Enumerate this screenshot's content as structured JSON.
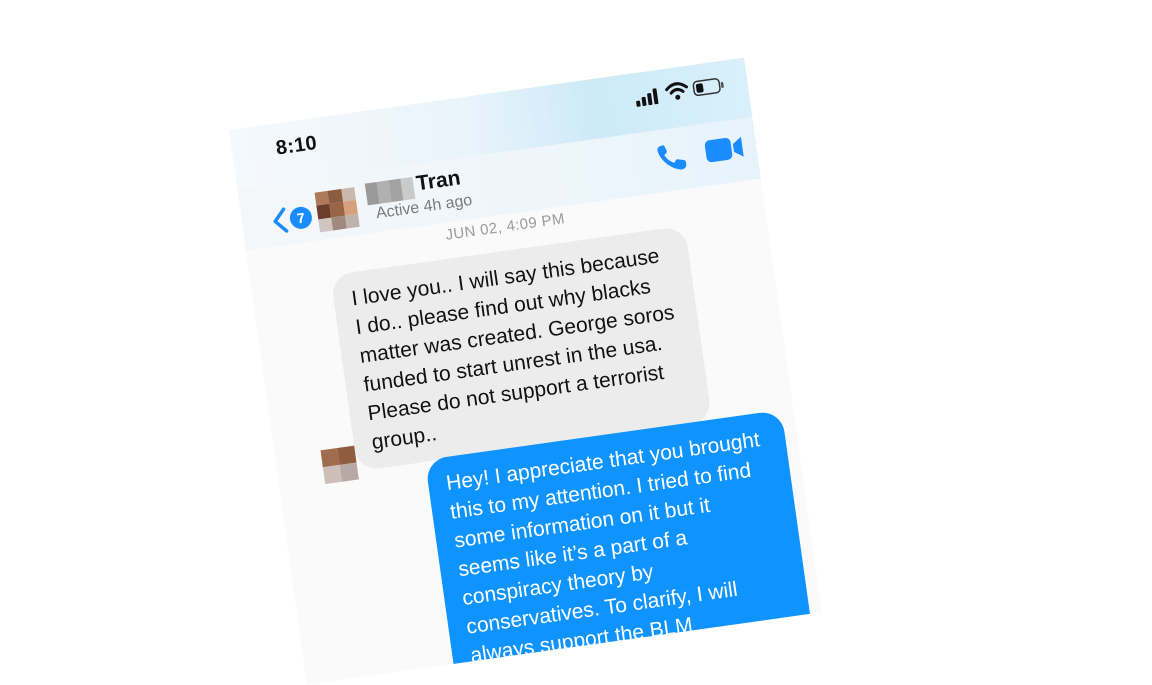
{
  "status_bar": {
    "time": "8:10",
    "icons": [
      "signal-icon",
      "wifi-icon",
      "battery-icon"
    ]
  },
  "header": {
    "back_badge_count": "7",
    "contact_name": "Tran",
    "contact_status": "Active 4h ago",
    "icons": [
      "chevron-left-icon",
      "phone-icon",
      "video-camera-icon"
    ]
  },
  "thread": {
    "date_stamp": "JUN 02, 4:09 PM",
    "messages": [
      {
        "direction": "incoming",
        "text": "I love you.. I will say this because I do.. please find out why blacks matter was created. George soros funded to start unrest in the usa. Please do not support a terrorist group.."
      },
      {
        "direction": "outgoing",
        "text": "Hey! I appreciate that you brought this to my attention. I tried to find some information on it but it seems like it’s a part of a conspiracy theory by conservatives. To clarify, I will always support the BLM movement. I have not donated"
      }
    ]
  },
  "colors": {
    "accent": "#0f94ff",
    "incoming_bubble": "#ececec",
    "badge": "#1a8cff"
  }
}
